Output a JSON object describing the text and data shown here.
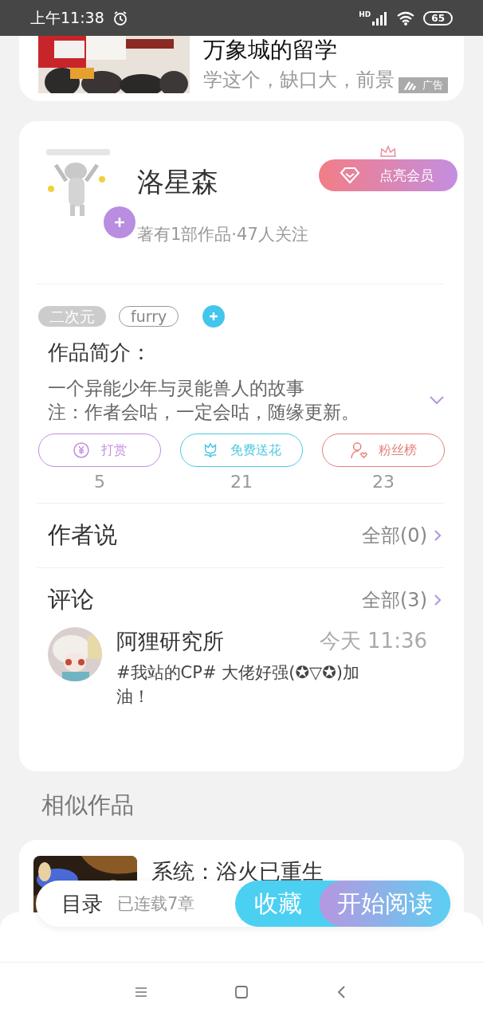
{
  "status_bar": {
    "time": "上午11:38",
    "network": "HD",
    "battery": "65"
  },
  "ad": {
    "title": "万象城的留学",
    "subtitle": "学这个，缺口大，前景",
    "badge": "广告"
  },
  "author": {
    "name": "洛星森",
    "stats": "著有1部作品·47人关注",
    "vip_button": "点亮会员"
  },
  "tags": [
    {
      "label": "二次元",
      "kind": "filled"
    },
    {
      "label": "furry",
      "kind": "outline"
    }
  ],
  "synopsis": {
    "heading": "作品简介：",
    "lines": [
      "一个异能少年与灵能兽人的故事",
      "注：作者会咕，一定会咕，随缘更新。"
    ]
  },
  "actions": [
    {
      "kind": "tip",
      "label": "打赏",
      "count": "5",
      "color": "#c08fe0"
    },
    {
      "kind": "flower",
      "label": "免费送花",
      "count": "21",
      "color": "#4cc8e0"
    },
    {
      "kind": "fans",
      "label": "粉丝榜",
      "count": "23",
      "color": "#e57f7a"
    }
  ],
  "author_notes": {
    "title": "作者说",
    "link": "全部(0)"
  },
  "comments": {
    "title": "评论",
    "link": "全部(3)",
    "items": [
      {
        "name": "阿狸研究所",
        "time": "今天 11:36",
        "text": "#我站的CP# 大佬好强(✪▽✪)加油！"
      }
    ]
  },
  "similar": {
    "heading": "相似作品",
    "items": [
      {
        "title": "系统：浴火已重生"
      }
    ]
  },
  "bottom_bar": {
    "toc": "目录",
    "progress": "已连载7章",
    "collect": "收藏",
    "read": "开始阅读"
  }
}
